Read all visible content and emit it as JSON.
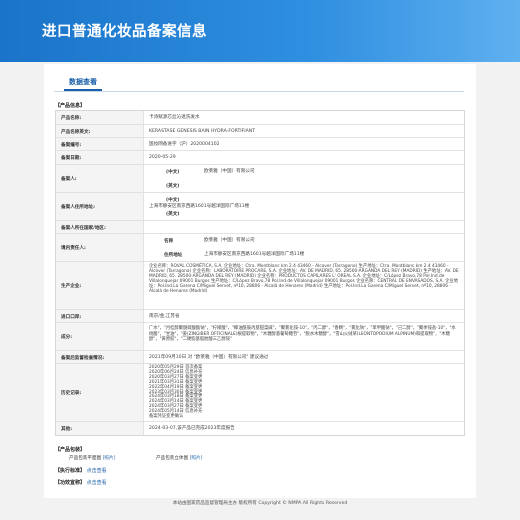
{
  "header": {
    "title": "进口普通化妆品备案信息"
  },
  "tab": {
    "label": "数据查看"
  },
  "product_section": {
    "title": "【产品信息】",
    "labels": {
      "name": "产品名称:",
      "name_en": "产品名称英文:",
      "record_no": "备案编号:",
      "record_date": "备案日期:",
      "filer": "备案人:",
      "zh": "(中文)",
      "en": "(英文)",
      "filer_addr": "备案人住所地址:",
      "filer_country": "备案人所在国家/地区:",
      "agent": "境内责任人:",
      "agent_name": "名称",
      "agent_addr": "住所地址",
      "producer": "生产企业:",
      "port": "进口口岸:",
      "ingredients": "成分:",
      "changes": "备案后监督检查情况:",
      "history": "历史记录:",
      "other": "其他:"
    },
    "values": {
      "name": "卡诗赋源芯丝沁透洗发水",
      "name_en": "KERASTASE GENESIS BAIN HYDRA-FORTIFIANT",
      "record_no": "国妆网备进字（沪）2020004102",
      "record_date": "2020-05-29",
      "filer_zh": "欧莱雅（中国）有限公司",
      "filer_en": "",
      "filer_addr_zh": "上海市静安区南京西路1601号越洋国际广场11楼",
      "filer_addr_en": "",
      "filer_country": "",
      "agent_name": "欧莱雅（中国）有限公司",
      "agent_addr": "上海市静安区南京西路1601号越洋国际广场11楼",
      "producer": "企业名称：ROVAL COSMÉTICA, S.A. 企业地址：Ctra. Montblanc km 2.4 43460 - Alcover (Tarragona) 生产地址：Ctra. Montblanc km 2.4 43460 - Alcover (Tarragona) 企业名称：LABORATOIRE PROCARE, S.A. 企业地址：AV. DE MADRID, 65. 28500-ARGANDA DEL REY (MADRID) 生产地址：AV. DE MADRID, 65. 28500-ARGANDA DEL REY (MADRID) 企业名称：PRODUCTOS CAPILARES L' OREAL S.A. 企业地址：C/López Bravo,78 Pol.Ind.de Villalonquejar 09001 Burgos 生产地址：C/López Bravo,78 Pol.Ind.de Villalonquejar 09001 Burgos 企业名称：CENTRAL DE ENVASADOS, S.A. 企业地址：Pol.Ind.La Garena C/Miguel Servet, nº10, 28806 - Alcalá de Henares (Madrid) 生产地址：Pol.Ind.La Garena C/Miguel Servet, nº10, 28806 - Alcalá de Henares (Madrid)",
      "port": "南京/金,江苏省",
      "ingredients": "广水\"，\"月桂醇聚醚硫酸酯钠\"，\"柠檬酸\"，\"椰油酰胺丙基甜菜碱\"，\"聚氯化铵-10\"，\"丙二醇\"，\"香精\"，\"氯化钠\"，\"苯甲酸钠\"，\"己二醇\"，\"聚季铵盐-10\"，\"水杨酸\"，\"甘油\"，\"姜(ZINGIBER OFFICINALE)根提取物\"，\"木糖醇基葡萄糖苷\"，\"脱水木糖醇\"，\"雪山火绒草(LEONTOPODIUM ALPINUM)和提取物\"，\"木糖醇\"，\"黄原胶\"，\"二硬脂基脂肪酸三乙醇铵\"",
      "changes": "2021年09月10日 对 \"欧莱雅（中国）有限公司\" 建议通过",
      "history": [
        "2020年05月29日 首次备案",
        "2020年06月24日 信息补充",
        "2020年03月27日 备案变更",
        "2021年03月31日 备案变更",
        "2022年04月19日 备案变更",
        "2023年03月30日 备案变更",
        "2024年03月18日 备案变更",
        "2024年03月14日 备案变更",
        "2024年03月27日 备案变更",
        "2024年05月14日 信息补充",
        "备案凭证变更确认"
      ],
      "other": "2024-03-07,该产品已完成2023年度报告"
    }
  },
  "photo_section": {
    "title": "【产品包装】",
    "front_label": "产品包装平面图",
    "front_link": "[照片]",
    "stereo_label": "产品包装立体图",
    "stereo_link": "[照片]"
  },
  "exec_standard": {
    "label": "【执行标准】",
    "link": "点击查看"
  },
  "efficacy": {
    "label": "【功效宣称】",
    "link": "点击查看"
  },
  "footer": {
    "text": "本站由国家药品监督管理局主办 版权所有 Copyright © NMPA All Rights Reserved"
  }
}
